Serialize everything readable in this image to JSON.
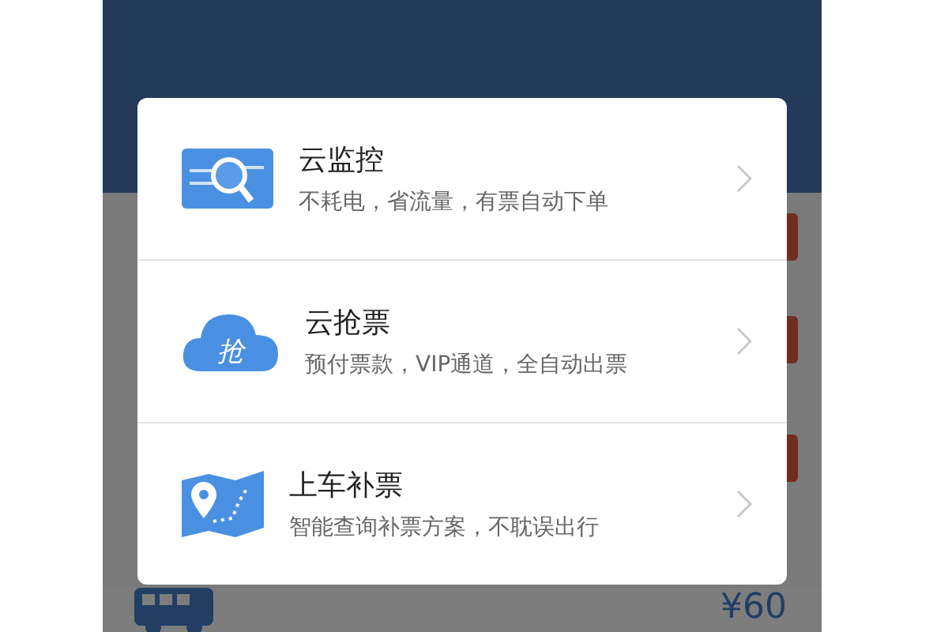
{
  "options": [
    {
      "kind": "monitor",
      "title": "云监控",
      "subtitle": "不耗电，省流量，有票自动下单"
    },
    {
      "kind": "grab",
      "title": "云抢票",
      "subtitle": "预付票款，VIP通道，全自动出票",
      "icon_text": "抢"
    },
    {
      "kind": "map",
      "title": "上车补票",
      "subtitle": "智能查询补票方案，不耽误出行"
    }
  ],
  "ticket": {
    "price": "¥60"
  }
}
